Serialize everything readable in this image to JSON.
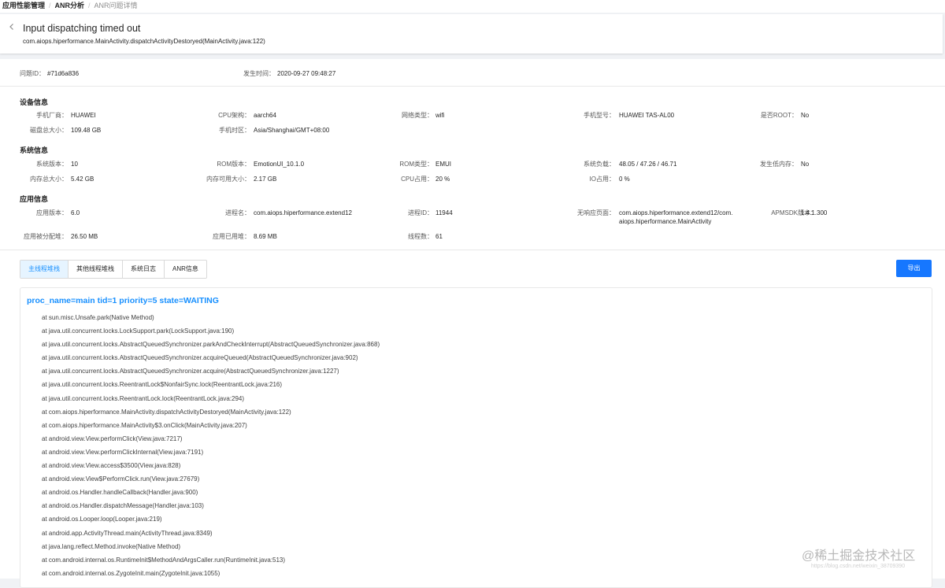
{
  "breadcrumb": {
    "items": [
      "应用性能管理",
      "ANR分析",
      "ANR问题详情"
    ],
    "separator": "/"
  },
  "header": {
    "title": "Input dispatching timed out",
    "subtitle": "com.aiops.hiperformance.MainActivity.dispatchActivityDestoryed(MainActivity.java:122)",
    "back_icon": "chevron-left-icon"
  },
  "issue": {
    "id_label": "问题ID：",
    "id_value": "#71d6a836",
    "time_label": "发生时间：",
    "time_value": "2020-09-27 09:48:27"
  },
  "device": {
    "title": "设备信息",
    "manufacturer_label": "手机厂商：",
    "manufacturer_value": "HUAWEI",
    "cpu_arch_label": "CPU架构：",
    "cpu_arch_value": "aarch64",
    "network_label": "网络类型：",
    "network_value": "wifi",
    "model_label": "手机型号：",
    "model_value": "HUAWEI TAS-AL00",
    "root_label": "是否ROOT：",
    "root_value": "No",
    "disk_label": "磁盘总大小：",
    "disk_value": "109.48 GB",
    "timezone_label": "手机时区：",
    "timezone_value": "Asia/Shanghai/GMT+08:00"
  },
  "system": {
    "title": "系统信息",
    "sys_version_label": "系统版本：",
    "sys_version_value": "10",
    "rom_version_label": "ROM版本：",
    "rom_version_value": "EmotionUI_10.1.0",
    "rom_type_label": "ROM类型：",
    "rom_type_value": "EMUI",
    "load_label": "系统负载：",
    "load_value": "48.05 / 47.26 / 46.71",
    "lowmem_label": "发生低内存：",
    "lowmem_value": "No",
    "mem_total_label": "内存总大小：",
    "mem_total_value": "5.42 GB",
    "mem_avail_label": "内存可用大小：",
    "mem_avail_value": "2.17 GB",
    "cpu_usage_label": "CPU占用：",
    "cpu_usage_value": "20 %",
    "io_label": "IO占用：",
    "io_value": "0 %"
  },
  "app": {
    "title": "应用信息",
    "app_version_label": "应用版本：",
    "app_version_value": "6.0",
    "process_label": "进程名：",
    "process_value": "com.aiops.hiperformance.extend12",
    "pid_label": "进程ID：",
    "pid_value": "11944",
    "unresponsive_label": "无响应页面：",
    "unresponsive_value_line1": "com.aiops.hiperformance.extend12/com.",
    "unresponsive_value_line2": "aiops.hiperformance.MainActivity",
    "sdk_label": "APMSDK版本：",
    "sdk_value": "1.4.1.300",
    "heap_alloc_label": "应用被分配堆：",
    "heap_alloc_value": "26.50 MB",
    "heap_used_label": "应用已用堆：",
    "heap_used_value": "8.69 MB",
    "threads_label": "线程数：",
    "threads_value": "61"
  },
  "tabs": [
    "主线程堆栈",
    "其他线程堆栈",
    "系统日志",
    "ANR信息"
  ],
  "export_label": "导出",
  "stack": {
    "thread_header": "proc_name=main tid=1 priority=5 state=WAITING",
    "frames": [
      "at sun.misc.Unsafe.park(Native Method)",
      "at java.util.concurrent.locks.LockSupport.park(LockSupport.java:190)",
      "at java.util.concurrent.locks.AbstractQueuedSynchronizer.parkAndCheckInterrupt(AbstractQueuedSynchronizer.java:868)",
      "at java.util.concurrent.locks.AbstractQueuedSynchronizer.acquireQueued(AbstractQueuedSynchronizer.java:902)",
      "at java.util.concurrent.locks.AbstractQueuedSynchronizer.acquire(AbstractQueuedSynchronizer.java:1227)",
      "at java.util.concurrent.locks.ReentrantLock$NonfairSync.lock(ReentrantLock.java:216)",
      "at java.util.concurrent.locks.ReentrantLock.lock(ReentrantLock.java:294)",
      "at com.aiops.hiperformance.MainActivity.dispatchActivityDestoryed(MainActivity.java:122)",
      "at com.aiops.hiperformance.MainActivity$3.onClick(MainActivity.java:207)",
      "at android.view.View.performClick(View.java:7217)",
      "at android.view.View.performClickInternal(View.java:7191)",
      "at android.view.View.access$3500(View.java:828)",
      "at android.view.View$PerformClick.run(View.java:27679)",
      "at android.os.Handler.handleCallback(Handler.java:900)",
      "at android.os.Handler.dispatchMessage(Handler.java:103)",
      "at android.os.Looper.loop(Looper.java:219)",
      "at android.app.ActivityThread.main(ActivityThread.java:8349)",
      "at java.lang.reflect.Method.invoke(Native Method)",
      "at com.android.internal.os.RuntimeInit$MethodAndArgsCaller.run(RuntimeInit.java:513)",
      "at com.android.internal.os.ZygoteInit.main(ZygoteInit.java:1055)"
    ]
  },
  "watermark": {
    "text": "@稀土掘金技术社区",
    "url": "https://blog.csdn.net/weixin_38709390"
  },
  "colors": {
    "accent": "#1890ff",
    "button": "#1677ff",
    "tab_active_bg": "#e6f4ff"
  }
}
